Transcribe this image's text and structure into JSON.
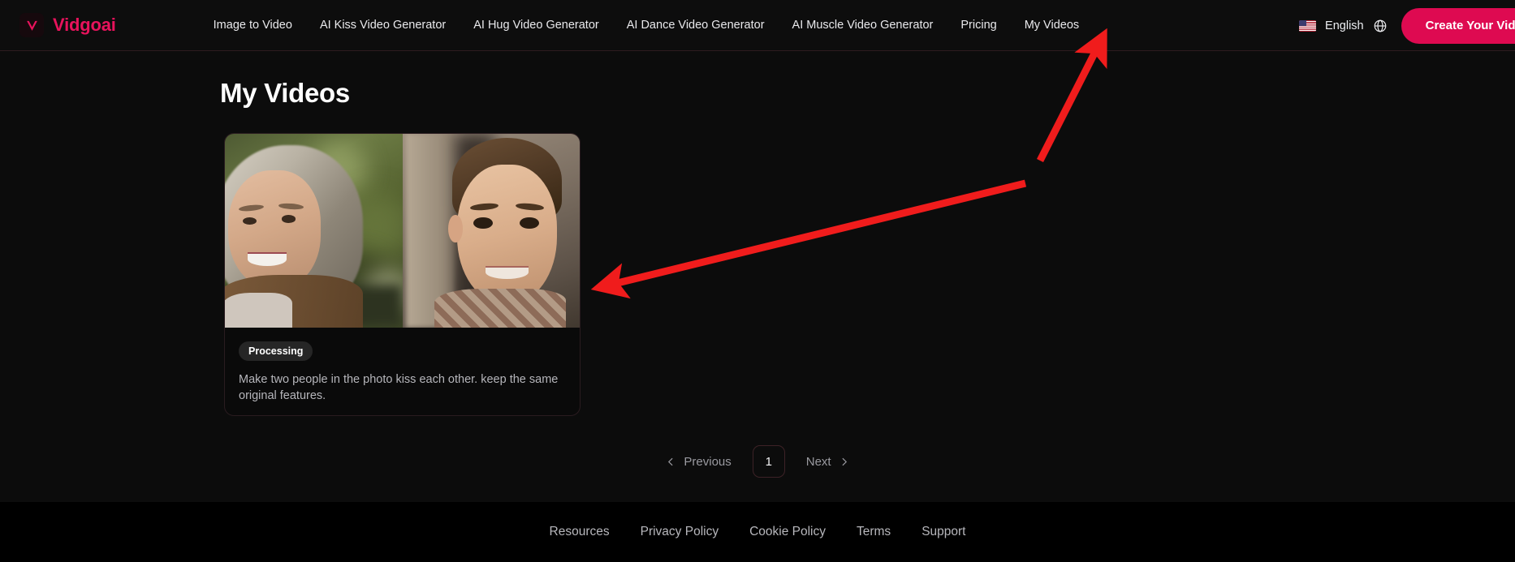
{
  "brand": {
    "name": "Vidgoai",
    "logo_icon": "v-logo-icon"
  },
  "nav": {
    "items": [
      {
        "label": "Image to Video"
      },
      {
        "label": "AI Kiss Video Generator"
      },
      {
        "label": "AI Hug Video Generator"
      },
      {
        "label": "AI Dance Video Generator"
      },
      {
        "label": "AI Muscle Video Generator"
      },
      {
        "label": "Pricing"
      },
      {
        "label": "My Videos"
      }
    ]
  },
  "header_right": {
    "flag_icon": "us-flag-icon",
    "language": "English",
    "globe_icon": "globe-icon",
    "cta_label": "Create Your Video"
  },
  "main": {
    "title": "My Videos",
    "card": {
      "status_badge": "Processing",
      "description": "Make two people in the photo kiss each other. keep the same original features.",
      "thumbnail_left_alt": "smiling older woman outdoors",
      "thumbnail_right_alt": "smiling young boy"
    },
    "pagination": {
      "previous_label": "Previous",
      "next_label": "Next",
      "current_page": "1",
      "prev_icon": "chevron-left-icon",
      "next_icon": "chevron-right-icon"
    }
  },
  "footer": {
    "links": [
      {
        "label": "Resources"
      },
      {
        "label": "Privacy Policy"
      },
      {
        "label": "Cookie Policy"
      },
      {
        "label": "Terms"
      },
      {
        "label": "Support"
      }
    ]
  },
  "annotations": {
    "arrow_color": "#f01c1c",
    "arrow_1_target": "My Videos",
    "arrow_2_target": "video card"
  },
  "colors": {
    "brand_pink": "#e8135c",
    "cta_background": "#de0a51",
    "page_background": "#0c0c0c",
    "footer_background": "#000000",
    "badge_background": "#262626"
  }
}
